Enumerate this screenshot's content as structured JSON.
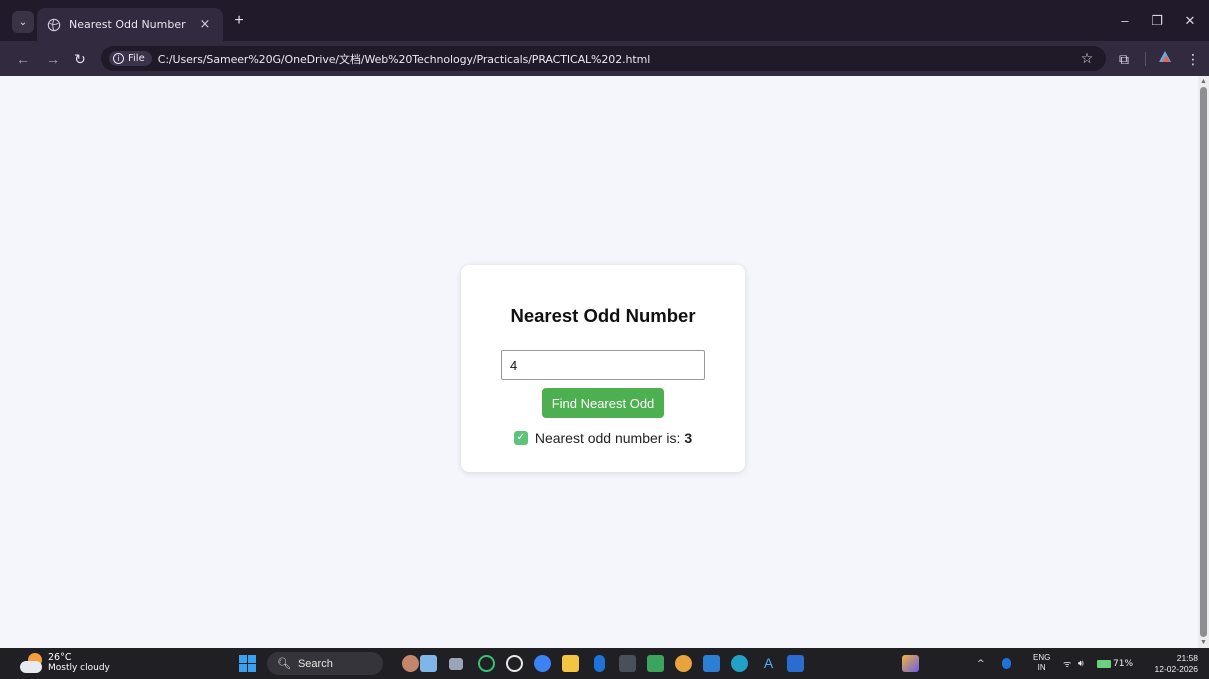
{
  "browser": {
    "tab_title": "Nearest Odd Number",
    "tab_close": "×",
    "new_tab": "+",
    "site_chip": "File",
    "url": "C:/Users/Sameer%20G/OneDrive/文档/Web%20Technology/Practicals/PRACTICAL%202.html",
    "window_controls": {
      "minimize": "–",
      "restore": "❐",
      "close": "✕"
    }
  },
  "page": {
    "heading": "Nearest Odd Number",
    "input_value": "4",
    "button_label": "Find Nearest Odd",
    "result_prefix": "Nearest odd number is:",
    "result_value": "3",
    "accent_color": "#4caf50"
  },
  "taskbar": {
    "weather_temp": "26°C",
    "weather_desc": "Mostly cloudy",
    "search_label": "Search",
    "lang_top": "ENG",
    "lang_bottom": "IN",
    "battery": "71%",
    "time": "21:58",
    "date": "12-02-2026",
    "apps": [
      "people",
      "files",
      "whatsapp",
      "chatgpt",
      "copilot",
      "file-explorer",
      "bluetooth",
      "terminal",
      "media",
      "chrome",
      "vscode",
      "edge",
      "autocad",
      "word",
      "paint"
    ]
  }
}
